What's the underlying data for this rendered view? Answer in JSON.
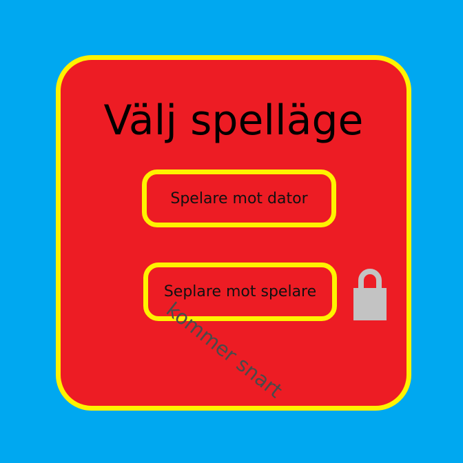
{
  "screen": {
    "background_color": "#00A8F0"
  },
  "panel": {
    "title": "Välj spelläge",
    "background_color": "#ED1C24",
    "border_color": "#FFF200"
  },
  "buttons": {
    "vs_computer_label": "Spelare mot dator",
    "vs_player_label": "Seplare mot spelare"
  },
  "lock": {
    "icon": "padlock-icon",
    "color": "#C3C3C3"
  },
  "overlay": {
    "coming_soon": "kommer snart"
  }
}
